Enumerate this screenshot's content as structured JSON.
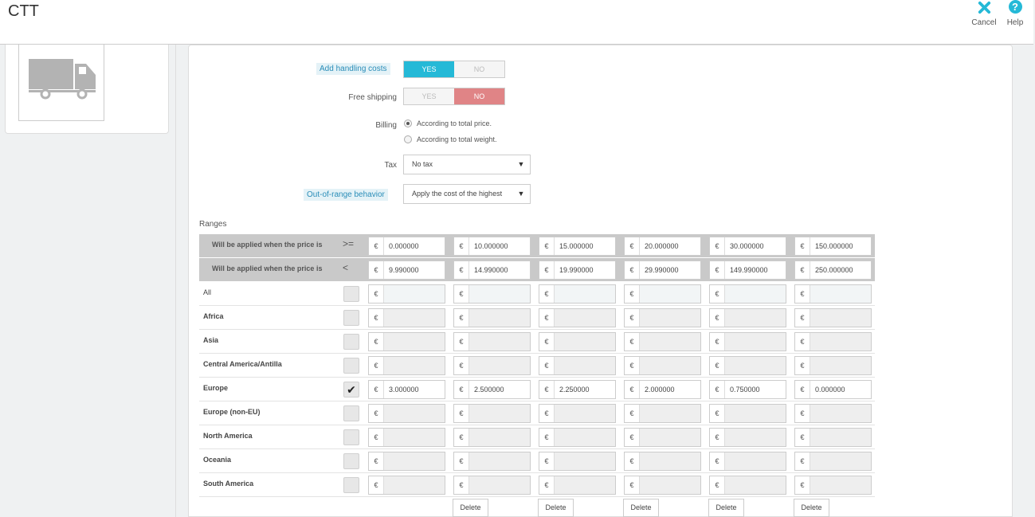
{
  "header": {
    "title": "CTT",
    "cancel_label": "Cancel",
    "help_label": "Help",
    "help_glyph": "?"
  },
  "form": {
    "handling": {
      "label": "Add handling costs",
      "yes": "YES",
      "no": "NO",
      "value": "YES"
    },
    "free_shipping": {
      "label": "Free shipping",
      "yes": "YES",
      "no": "NO",
      "value": "NO"
    },
    "billing": {
      "label": "Billing",
      "options": [
        "According to total price.",
        "According to total weight."
      ],
      "selected": 0
    },
    "tax": {
      "label": "Tax",
      "value": "No tax"
    },
    "out_of_range": {
      "label": "Out-of-range behavior",
      "value": "Apply the cost of the highest"
    }
  },
  "ranges": {
    "label": "Ranges",
    "currency": "€",
    "from_row": {
      "label": "Will be applied when the price is",
      "op": ">=",
      "values": [
        "0.000000",
        "10.000000",
        "15.000000",
        "20.000000",
        "30.000000",
        "150.000000"
      ]
    },
    "to_row": {
      "label": "Will be applied when the price is",
      "op": "<",
      "values": [
        "9.990000",
        "14.990000",
        "19.990000",
        "29.990000",
        "149.990000",
        "250.000000"
      ]
    },
    "zones": [
      {
        "name": "All",
        "checked": false,
        "values": [
          "",
          "",
          "",
          "",
          "",
          ""
        ]
      },
      {
        "name": "Africa",
        "checked": false,
        "values": [
          "",
          "",
          "",
          "",
          "",
          ""
        ]
      },
      {
        "name": "Asia",
        "checked": false,
        "values": [
          "",
          "",
          "",
          "",
          "",
          ""
        ]
      },
      {
        "name": "Central America/Antilla",
        "checked": false,
        "values": [
          "",
          "",
          "",
          "",
          "",
          ""
        ]
      },
      {
        "name": "Europe",
        "checked": true,
        "values": [
          "3.000000",
          "2.500000",
          "2.250000",
          "2.000000",
          "0.750000",
          "0.000000"
        ]
      },
      {
        "name": "Europe (non-EU)",
        "checked": false,
        "values": [
          "",
          "",
          "",
          "",
          "",
          ""
        ]
      },
      {
        "name": "North America",
        "checked": false,
        "values": [
          "",
          "",
          "",
          "",
          "",
          ""
        ]
      },
      {
        "name": "Oceania",
        "checked": false,
        "values": [
          "",
          "",
          "",
          "",
          "",
          ""
        ]
      },
      {
        "name": "South America",
        "checked": false,
        "values": [
          "",
          "",
          "",
          "",
          "",
          ""
        ]
      }
    ],
    "delete_label": "Delete",
    "checkmark": "✔"
  },
  "colors": {
    "accent": "#25b9d7",
    "no_active": "#e08486",
    "header_row": "#c9c9c9"
  },
  "icons": {
    "cancel": "close-icon",
    "help": "help-icon",
    "carrier": "truck-icon"
  }
}
